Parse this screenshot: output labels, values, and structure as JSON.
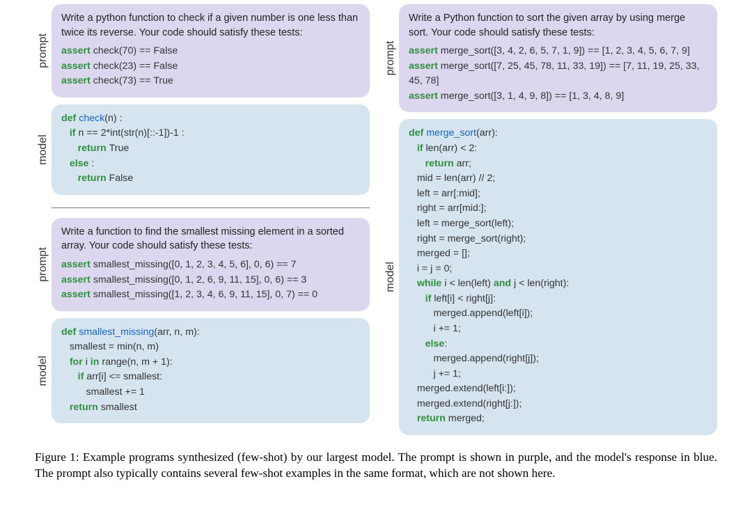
{
  "labels": {
    "prompt": "prompt",
    "model": "model"
  },
  "left": {
    "ex1": {
      "promptDesc": "Write a python function to check if a given number is one less than twice its reverse. Your code should satisfy these tests:",
      "asserts": [
        {
          "kw": "assert",
          "call": "check(70)",
          "rest": " == False"
        },
        {
          "kw": "assert",
          "call": "check(23)",
          "rest": " == False"
        },
        {
          "kw": "assert",
          "call": "check(73)",
          "rest": " == True"
        }
      ],
      "model": {
        "l1a": "def ",
        "l1b": "check",
        "l1c": "(n) :",
        "l2a": "   if ",
        "l2b": "n == 2*int(str(n)[::-1])-1 :",
        "l3a": "      return ",
        "l3b": "True",
        "l4a": "   else ",
        "l4b": ":",
        "l5a": "      return ",
        "l5b": "False"
      }
    },
    "ex2": {
      "promptDesc": "Write a function to find the smallest missing element in a sorted array. Your code should satisfy these tests:",
      "asserts": [
        {
          "kw": "assert",
          "call": "smallest_missing([0, 1, 2, 3, 4, 5, 6], 0, 6)",
          "rest": " == 7"
        },
        {
          "kw": "assert",
          "call": "smallest_missing([0, 1, 2, 6, 9, 11, 15], 0, 6)",
          "rest": " == 3"
        },
        {
          "kw": "assert",
          "call": "smallest_missing([1, 2, 3, 4, 6, 9, 11, 15], 0, 7)",
          "rest": " == 0"
        }
      ],
      "model": {
        "l1a": "def ",
        "l1b": "smallest_missing",
        "l1c": "(arr, n, m):",
        "l2": "   smallest = min(n, m)",
        "l3a": "   for ",
        "l3b": "i ",
        "l3c": "in ",
        "l3d": "range(n, m + 1):",
        "l4a": "      if ",
        "l4b": "arr[i] <= smallest:",
        "l5": "         smallest += 1",
        "l6a": "   return ",
        "l6b": "smallest"
      }
    }
  },
  "right": {
    "ex1": {
      "promptDesc": "Write a Python function to sort the given array by using merge sort. Your code should satisfy these tests:",
      "asserts": [
        {
          "kw": "assert",
          "call": "merge_sort([3, 4, 2, 6, 5, 7, 1, 9])",
          "rest": " == [1, 2, 3, 4, 5, 6, 7, 9]"
        },
        {
          "kw": "assert",
          "call": "merge_sort([7, 25, 45, 78, 11, 33, 19])",
          "rest": " == [7, 11, 19, 25, 33, 45, 78]"
        },
        {
          "kw": "assert",
          "call": "merge_sort([3, 1, 4, 9, 8])",
          "rest": " == [1, 3, 4, 8, 9]"
        }
      ],
      "model": {
        "l1a": "def ",
        "l1b": "merge_sort",
        "l1c": "(arr):",
        "l2a": "   if ",
        "l2b": "len(arr) < 2:",
        "l3a": "      return ",
        "l3b": "arr;",
        "l4": "   mid = len(arr) // 2;",
        "l5": "   left = arr[:mid];",
        "l6": "   right = arr[mid:];",
        "l7": "   left = merge_sort(left);",
        "l8": "   right = merge_sort(right);",
        "l9": "   merged = [];",
        "l10": "   i = j = 0;",
        "l11a": "   while ",
        "l11b": "i < len(left) ",
        "l11c": "and ",
        "l11d": "j < len(right):",
        "l12a": "      if ",
        "l12b": "left[i] < right[j]:",
        "l13": "         merged.append(left[i]);",
        "l14": "         i += 1;",
        "l15a": "      else",
        "l15b": ":",
        "l16": "         merged.append(right[j]);",
        "l17": "         j += 1;",
        "l18": "   merged.extend(left[i:]);",
        "l19": "   merged.extend(right[j:]);",
        "l20a": "   return ",
        "l20b": "merged;"
      }
    }
  },
  "caption": "Figure 1: Example programs synthesized (few-shot) by our largest model. The prompt is shown in purple, and the model's response in blue. The prompt also typically contains several few-shot examples in the same format, which are not shown here."
}
